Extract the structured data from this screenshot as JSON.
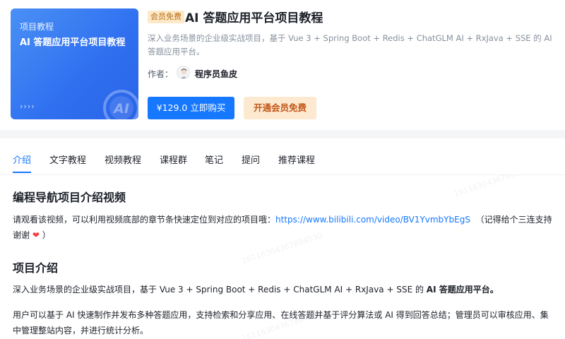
{
  "course": {
    "cover": {
      "small_title": "项目教程",
      "big_title": "AI 答题应用平台项目教程",
      "arrows": "››››",
      "logo_text": "AI"
    },
    "tag": "会员免费",
    "title": "AI 答题应用平台项目教程",
    "description": "深入业务场景的企业级实战项目，基于 Vue 3 + Spring Boot + Redis + ChatGLM AI + RxJava + SSE 的 AI 答题应用平台。",
    "author_label": "作者：",
    "author_name": "程序员鱼皮",
    "buy_button": "¥129.0 立即购买",
    "vip_button": "开通会员免费"
  },
  "tabs": [
    {
      "label": "介绍",
      "active": true
    },
    {
      "label": "文字教程",
      "active": false
    },
    {
      "label": "视频教程",
      "active": false
    },
    {
      "label": "课程群",
      "active": false
    },
    {
      "label": "笔记",
      "active": false
    },
    {
      "label": "提问",
      "active": false
    },
    {
      "label": "推荐课程",
      "active": false
    }
  ],
  "content": {
    "section1_title": "编程导航项目介绍视频",
    "section1_text_before": "请观看该视频，可以利用视频底部的章节条快速定位到对应的项目哦：",
    "section1_link": "https://www.bilibili.com/video/BV1YvmbYbEgS",
    "section1_text_after": "（记得给个三连支持谢谢",
    "section1_text_end": "）",
    "heart": "❤",
    "section2_title": "项目介绍",
    "section2_p1_before": "深入业务场景的企业级实战项目，基于 Vue 3 + Spring Boot + Redis + ChatGLM AI + RxJava + SSE 的 ",
    "section2_p1_bold": "AI 答题应用平台。",
    "section2_p2": "用户可以基于 AI 快速制作并发布多种答题应用，支持检索和分享应用、在线答题并基于评分算法或 AI 得到回答总结；管理员可以审核应用、集中管理整站内容，并进行统计分析。"
  },
  "watermark": "16116304367894530",
  "colors": {
    "primary": "#1677ff",
    "vip_text": "#c1561a",
    "vip_bg": "#fde9cf",
    "tag_bg": "#fde9c8",
    "cover_blue": "#2f6ff0"
  }
}
